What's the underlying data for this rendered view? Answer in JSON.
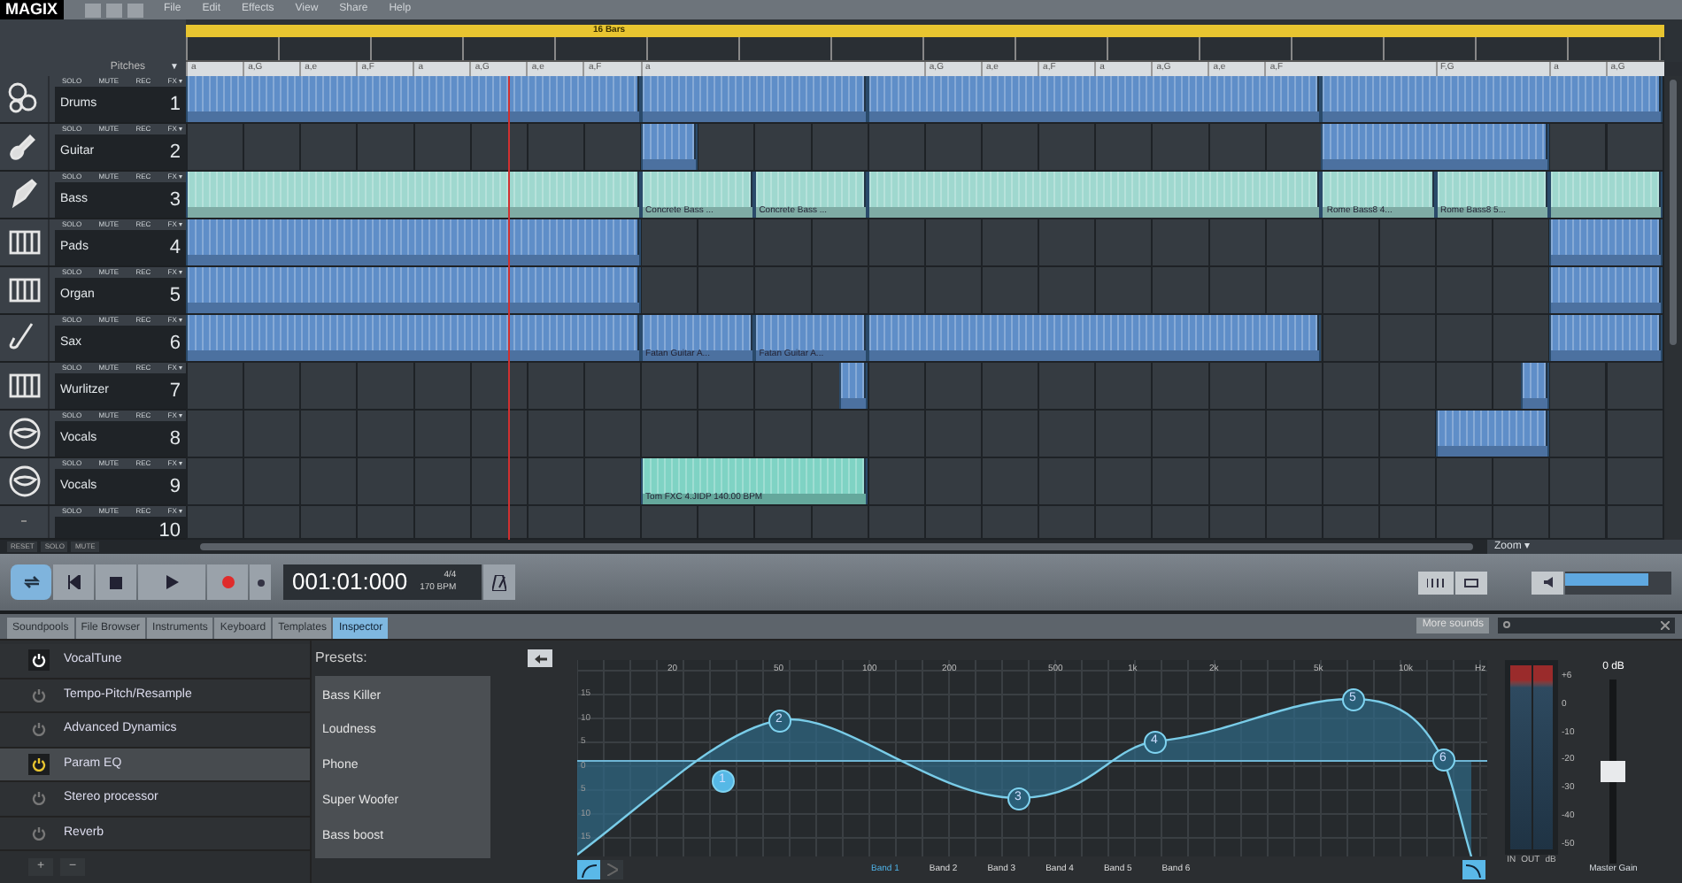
{
  "menu": [
    "File",
    "Edit",
    "Effects",
    "View",
    "Share",
    "Help"
  ],
  "logo": "MAGIX",
  "loop": {
    "label": "16 Bars"
  },
  "pitch_header": "Pitches",
  "pitch_caret": "▼",
  "chords": [
    {
      "text": "a"
    },
    {
      "text": "a,G"
    },
    {
      "text": "a,e"
    },
    {
      "text": "a,F"
    },
    {
      "text": "a"
    },
    {
      "text": "a,G"
    },
    {
      "text": "a,e"
    },
    {
      "text": "a,F"
    },
    {
      "text": "a"
    },
    {
      "text": "a,G"
    },
    {
      "text": "a,e"
    },
    {
      "text": "a,F"
    },
    {
      "text": "a"
    },
    {
      "text": "a,G"
    },
    {
      "text": "a,e"
    },
    {
      "text": "a,F"
    },
    {
      "text": "F,G"
    },
    {
      "text": "a"
    },
    {
      "text": "a,G"
    }
  ],
  "tracks": [
    {
      "name": "Drums",
      "number": "1",
      "buttons": [
        "SOLO",
        "MUTE",
        "REC",
        "FX ▾"
      ],
      "clips": [
        {
          "color": "#5f8ec8"
        },
        {
          "color": "#5f8ec8"
        },
        {
          "color": "#5f8ec8"
        },
        {
          "color": "#5f8ec8"
        }
      ]
    },
    {
      "name": "Guitar",
      "number": "2",
      "buttons": [
        "SOLO",
        "MUTE",
        "REC",
        "FX ▾"
      ],
      "clips": [
        {
          "color": "#5f8ec8"
        },
        {
          "color": "#5f8ec8"
        }
      ]
    },
    {
      "name": "Bass",
      "number": "3",
      "buttons": [
        "SOLO",
        "MUTE",
        "REC",
        "FX ▾"
      ],
      "clips": [
        {
          "color": "#9fd8cf"
        },
        {
          "color": "#9fd8cf",
          "label": "Concrete Bass ..."
        },
        {
          "color": "#9fd8cf",
          "label": "Concrete Bass ..."
        },
        {
          "color": "#9fd8cf"
        },
        {
          "color": "#9fd8cf",
          "label": "Rome Bass8 4..."
        },
        {
          "color": "#9fd8cf",
          "label": "Rome Bass8 5..."
        },
        {
          "color": "#9fd8cf"
        }
      ]
    },
    {
      "name": "Pads",
      "number": "4",
      "buttons": [
        "SOLO",
        "MUTE",
        "REC",
        "FX ▾"
      ],
      "clips": [
        {
          "color": "#5f8ec8"
        },
        {
          "color": "#5f8ec8"
        }
      ]
    },
    {
      "name": "Organ",
      "number": "5",
      "buttons": [
        "SOLO",
        "MUTE",
        "REC",
        "FX ▾"
      ],
      "clips": [
        {
          "color": "#5f8ec8"
        },
        {
          "color": "#5f8ec8"
        }
      ]
    },
    {
      "name": "Sax",
      "number": "6",
      "buttons": [
        "SOLO",
        "MUTE",
        "REC",
        "FX ▾"
      ],
      "clips": [
        {
          "color": "#5f8ec8"
        },
        {
          "color": "#5f8ec8",
          "label": "Fatan Guitar A..."
        },
        {
          "color": "#5f8ec8",
          "label": "Fatan Guitar A..."
        },
        {
          "color": "#5f8ec8"
        },
        {
          "color": "#5f8ec8"
        }
      ]
    },
    {
      "name": "Wurlitzer",
      "number": "7",
      "buttons": [
        "SOLO",
        "MUTE",
        "REC",
        "FX ▾"
      ],
      "clips": [
        {
          "color": "#5f8ec8"
        },
        {
          "color": "#5f8ec8"
        }
      ]
    },
    {
      "name": "Vocals",
      "number": "8",
      "buttons": [
        "SOLO",
        "MUTE",
        "REC",
        "FX ▾"
      ],
      "clips": [
        {
          "color": "#5f8ec8"
        }
      ]
    },
    {
      "name": "Vocals",
      "number": "9",
      "buttons": [
        "SOLO",
        "MUTE",
        "REC",
        "FX ▾"
      ],
      "clips": [
        {
          "color": "#7fd3c4",
          "label": "Tom FXC 4.JIDP  140.00 BPM"
        }
      ]
    },
    {
      "number": "10",
      "buttons": [
        "SOLO",
        "MUTE",
        "REC",
        "FX ▾"
      ]
    }
  ],
  "footer_buttons": [
    "RESET",
    "SOLO",
    "MUTE"
  ],
  "zoom_label": "Zoom ▾",
  "transport": {
    "time": "001:01:000",
    "signature": "4/4",
    "tempo": "170 BPM",
    "volume": {
      "level": 0.78
    }
  },
  "tabs": [
    {
      "label": "Soundpools",
      "selected": false
    },
    {
      "label": "File Browser",
      "selected": false
    },
    {
      "label": "Instruments",
      "selected": false
    },
    {
      "label": "Keyboard",
      "selected": false
    },
    {
      "label": "Templates",
      "selected": false
    },
    {
      "label": "Inspector",
      "selected": true
    }
  ],
  "more_sounds": "More sounds",
  "effects": [
    {
      "name": "VocalTune",
      "on": true,
      "selected": false
    },
    {
      "name": "Tempo-Pitch/Resample",
      "on": false,
      "selected": false
    },
    {
      "name": "Advanced Dynamics",
      "on": false,
      "selected": false
    },
    {
      "name": "Param EQ",
      "on": true,
      "selected": true
    },
    {
      "name": "Stereo processor",
      "on": false,
      "selected": false
    },
    {
      "name": "Reverb",
      "on": false,
      "selected": false
    }
  ],
  "effect_buttons": [
    "+",
    "−"
  ],
  "presets": {
    "title": "Presets:",
    "items": [
      "Bass Killer",
      "Loudness",
      "Phone",
      "Super Woofer",
      "Bass boost"
    ]
  },
  "eq": {
    "freq_labels": [
      "20",
      "50",
      "100",
      "200",
      "500",
      "1k",
      "2k",
      "5k",
      "10k",
      "Hz"
    ],
    "db_labels": [
      "15",
      "10",
      "5",
      "0",
      "5",
      "10",
      "15"
    ],
    "nodes": [
      "1",
      "2",
      "3",
      "4",
      "5",
      "6"
    ],
    "bands": [
      {
        "label": "Band 1",
        "selected": true
      },
      {
        "label": "Band 2",
        "selected": false
      },
      {
        "label": "Band 3",
        "selected": false
      },
      {
        "label": "Band 4",
        "selected": false
      },
      {
        "label": "Band 5",
        "selected": false
      },
      {
        "label": "Band 6",
        "selected": false
      }
    ]
  },
  "meter": {
    "scale": [
      "+6",
      "0",
      "-10",
      "-20",
      "-30",
      "-40",
      "-50"
    ],
    "labels": [
      "IN",
      "OUT",
      "dB"
    ]
  },
  "master": {
    "reading": "0 dB",
    "label": "Master Gain",
    "level": 0.5
  }
}
